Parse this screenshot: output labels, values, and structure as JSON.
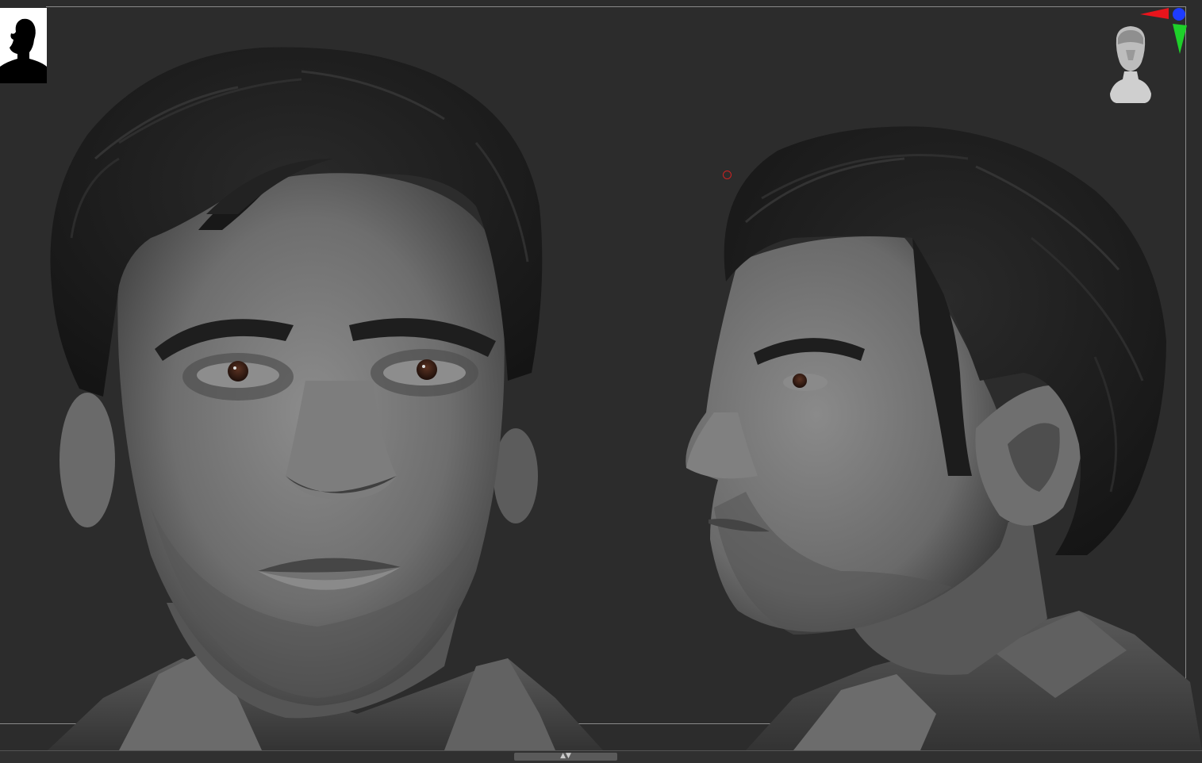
{
  "viewport": {
    "background": "#2c2c2c",
    "frame_color": "#8a8a8a"
  },
  "thumbnail": {
    "icon": "silhouette-icon",
    "background": "#ffffff",
    "fill": "#000000"
  },
  "navigation_gizmo": {
    "icon": "head-gizmo-icon",
    "axis_colors": {
      "x": "#e8141c",
      "y": "#1ed02a",
      "z": "#1e3cff"
    }
  },
  "model": {
    "views": [
      "front-view",
      "side-view"
    ],
    "clay_color": "#7a7a7a",
    "hair_color": "#1f1f1f",
    "iris_color": "#3a1e14"
  },
  "bottom_bar": {
    "scroll_glyph": "▲▼"
  }
}
